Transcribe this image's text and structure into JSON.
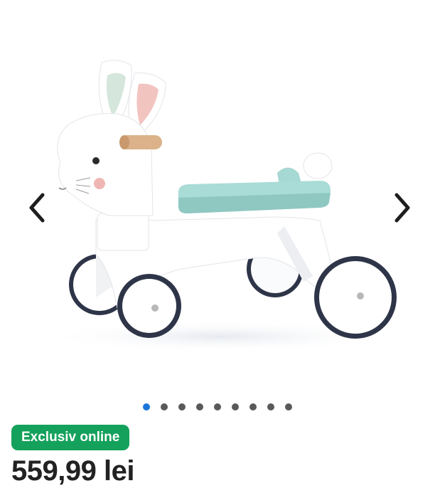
{
  "gallery": {
    "image_alt": "White wooden bunny balance bike with mint seat",
    "prev_icon": "chevron-left-icon",
    "next_icon": "chevron-right-icon",
    "total_images": 9,
    "active_index": 0,
    "colors": {
      "active_dot": "#1b75d8",
      "inactive_dot": "#595959"
    }
  },
  "product": {
    "badge_label": "Exclusiv online",
    "badge_color": "#14a15c",
    "price": "559,99 lei"
  }
}
